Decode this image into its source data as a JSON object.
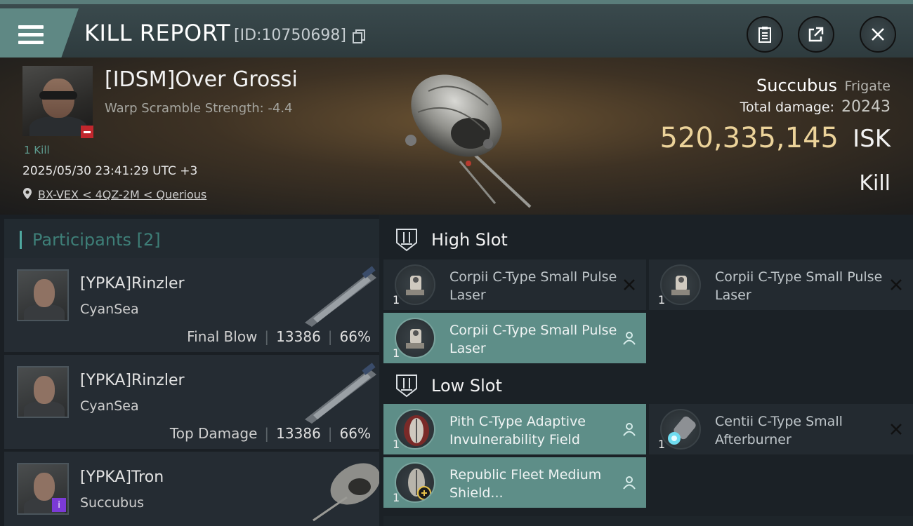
{
  "header": {
    "title": "KILL REPORT",
    "report_id": "[ID:10750698]"
  },
  "victim": {
    "name": "[IDSM]Over Grossi",
    "warp_scramble": "Warp Scramble Strength: -4.4",
    "kill_count": "1 Kill",
    "timestamp": "2025/05/30 23:41:29 UTC +3",
    "location": "BX-VEX < 4QZ-2M < Querious",
    "ship_name": "Succubus",
    "ship_class": "Frigate",
    "total_damage_label": "Total damage:",
    "total_damage": "20243",
    "isk_value": "520,335,145",
    "isk_unit": "ISK",
    "result": "Kill"
  },
  "participants": {
    "title": "Participants [2]",
    "rows": [
      {
        "name": "[YPKA]Rinzler",
        "ship": "CyanSea",
        "label": "Final Blow",
        "damage": "13386",
        "percent": "66%"
      },
      {
        "name": "[YPKA]Rinzler",
        "ship": "CyanSea",
        "label": "Top Damage",
        "damage": "13386",
        "percent": "66%"
      },
      {
        "name": "[YPKA]Tron",
        "ship": "Succubus",
        "label": "",
        "damage": "",
        "percent": ""
      }
    ]
  },
  "fitting": {
    "high_slot_title": "High Slot",
    "low_slot_title": "Low Slot",
    "high": [
      {
        "qty": "1",
        "name": "Corpii C-Type Small Pulse Laser",
        "status": "destroyed",
        "icon": "laser-icon"
      },
      {
        "qty": "1",
        "name": "Corpii C-Type Small Pulse Laser",
        "status": "destroyed",
        "icon": "laser-icon"
      },
      {
        "qty": "1",
        "name": "Corpii C-Type Small Pulse Laser",
        "status": "dropped",
        "icon": "laser-icon"
      }
    ],
    "low": [
      {
        "qty": "1",
        "name": "Pith C-Type Adaptive Invulnerability Field",
        "status": "dropped",
        "icon": "shield-field-icon"
      },
      {
        "qty": "1",
        "name": "Centii C-Type Small Afterburner",
        "status": "destroyed",
        "icon": "afterburner-icon"
      },
      {
        "qty": "1",
        "name": "Republic Fleet Medium Shield...",
        "status": "dropped",
        "icon": "shield-extender-icon"
      }
    ]
  },
  "colors": {
    "accent": "#5f8884",
    "isk": "#ecd39a",
    "dropped_bg": "#5e8e88",
    "destroyed_bg": "#232a30"
  }
}
